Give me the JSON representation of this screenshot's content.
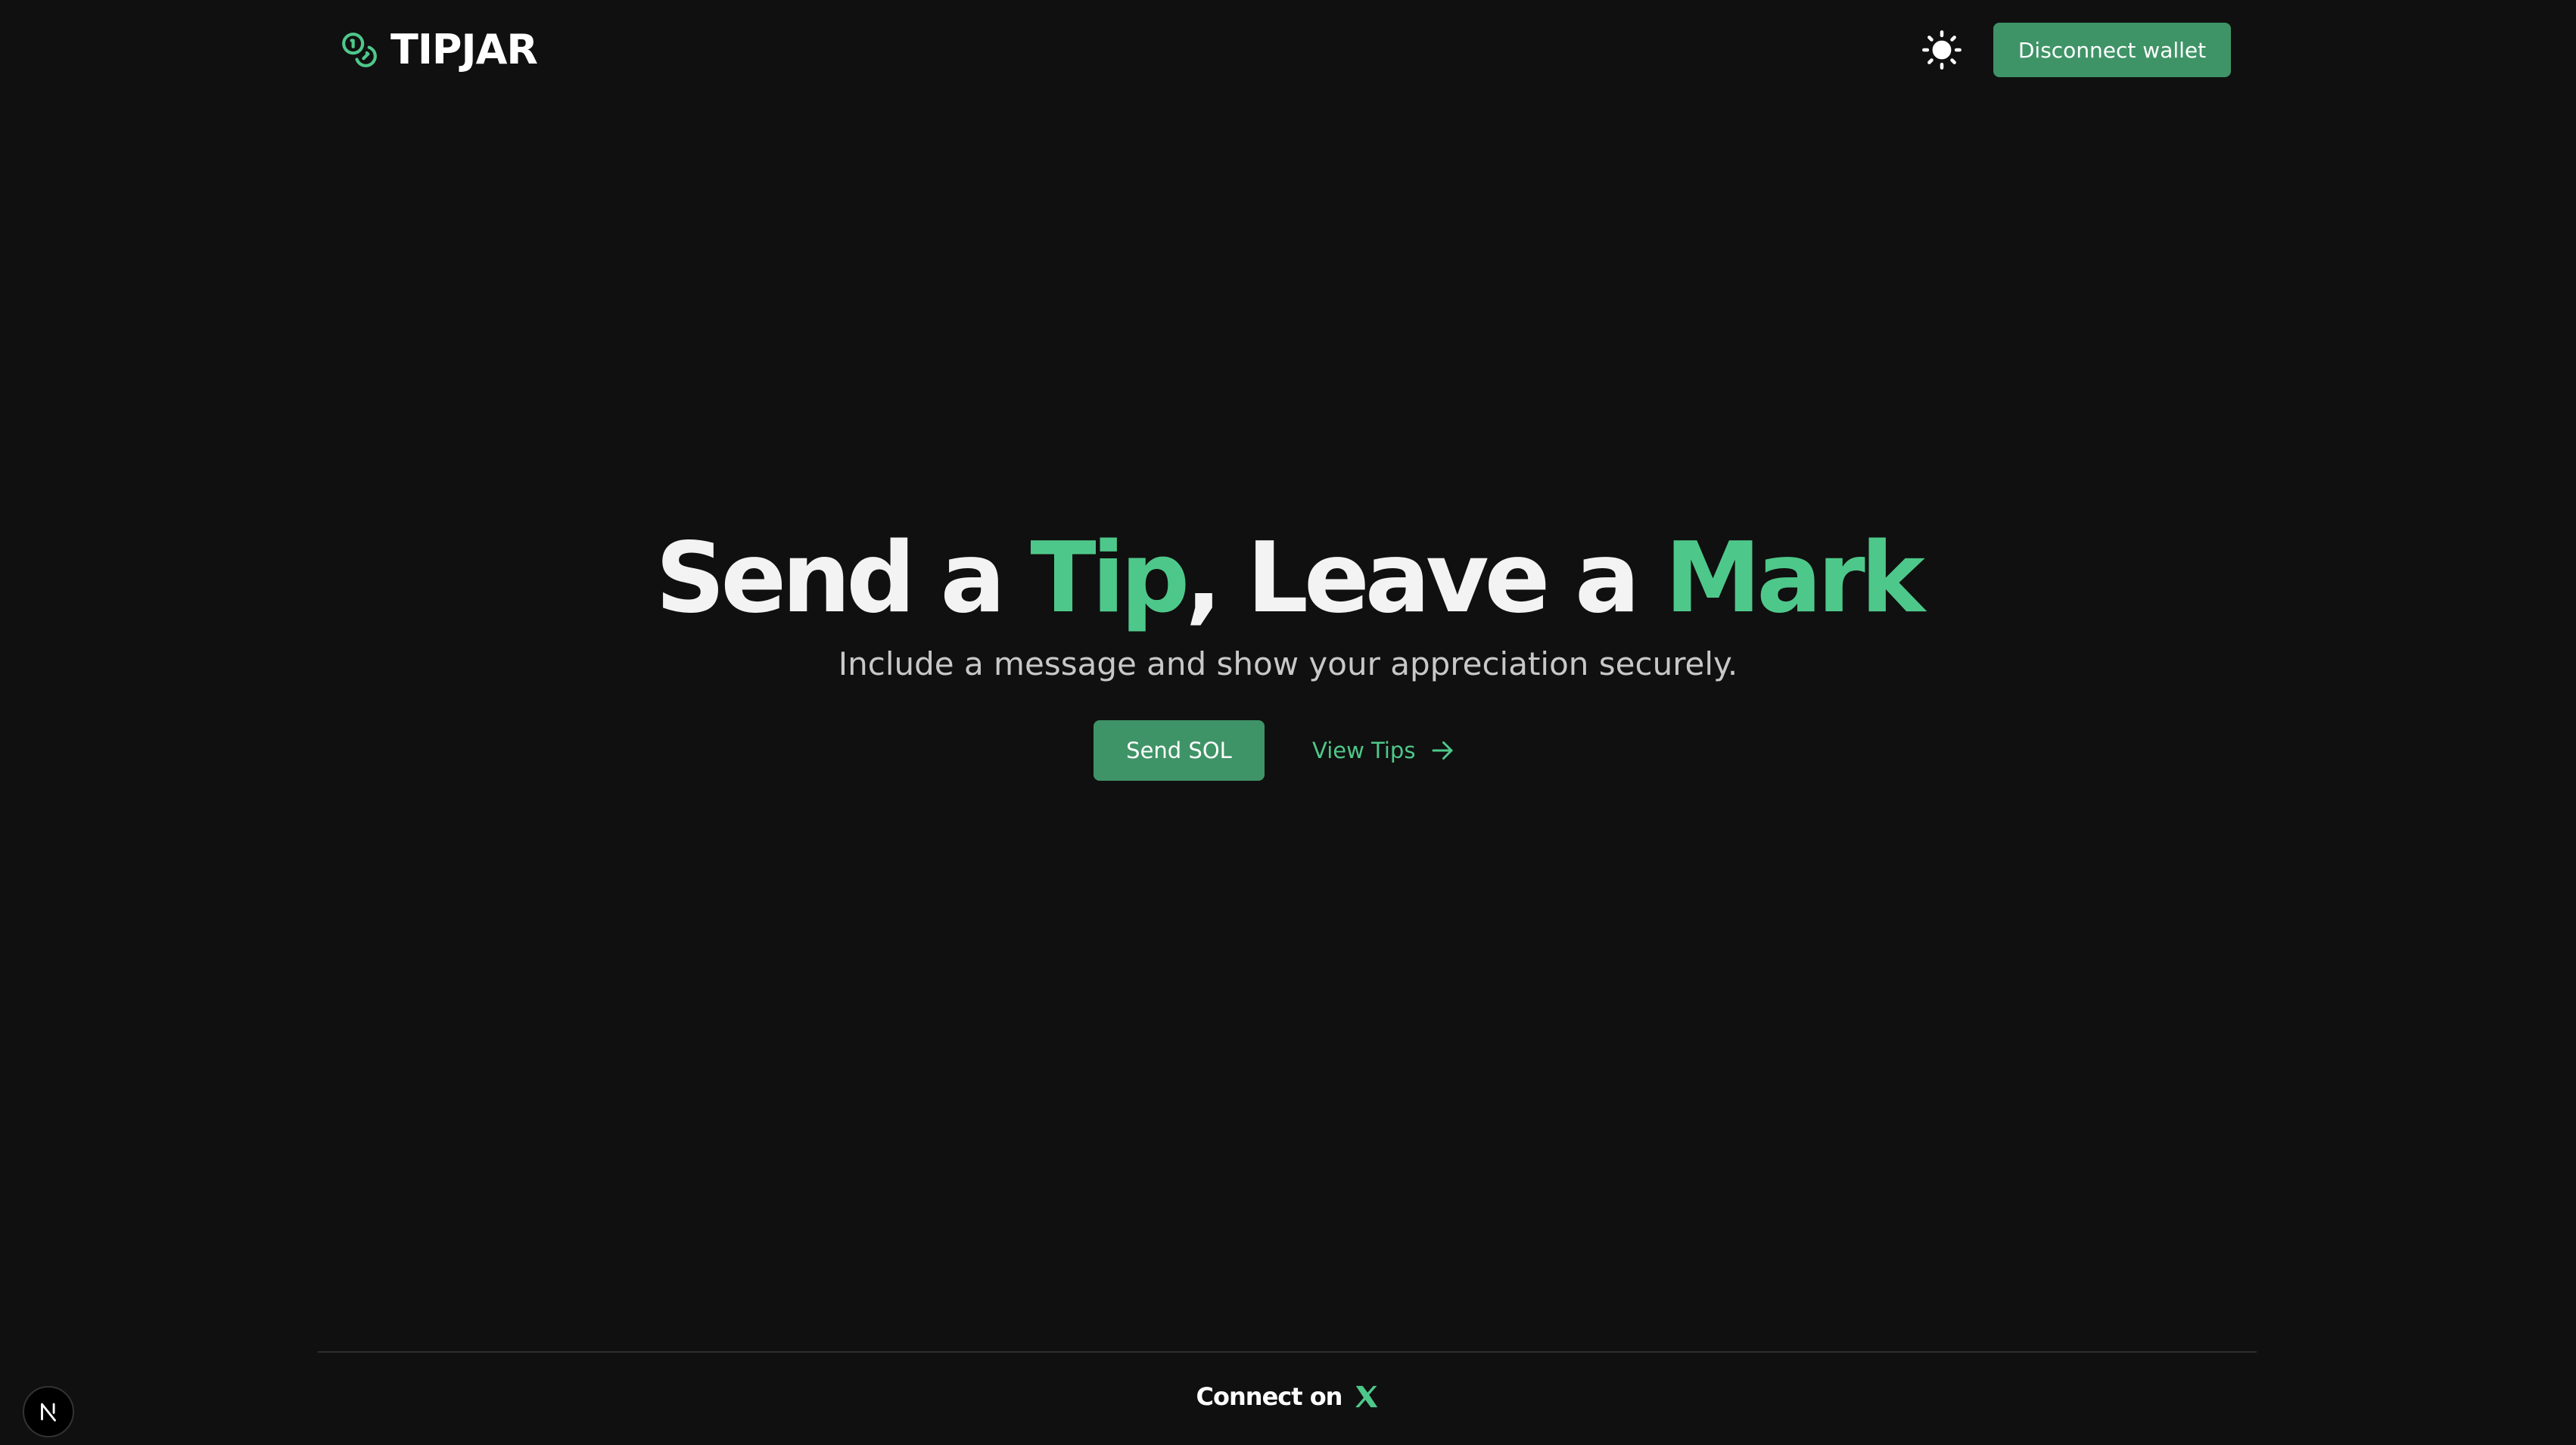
{
  "header": {
    "logo_text": "TIPJAR",
    "logo_icon": "coins-icon",
    "theme_toggle_icon": "sun-icon",
    "disconnect_label": "Disconnect wallet"
  },
  "hero": {
    "title_parts": [
      "Send a ",
      "Tip",
      ", Leave a ",
      "Mark"
    ],
    "subtitle": "Include a message and show your appreciation securely.",
    "send_label": "Send SOL",
    "view_tips_label": "View Tips",
    "view_tips_icon": "arrow-right-icon"
  },
  "footer": {
    "connect_label": "Connect on",
    "connect_icon": "x-logo-icon"
  },
  "dev_badge": {
    "icon": "nextjs-logo-icon"
  },
  "colors": {
    "background": "#101010",
    "accent": "#4ec88a",
    "button": "#3f9467",
    "text": "#ffffff",
    "muted_text": "#c8c8c8"
  }
}
